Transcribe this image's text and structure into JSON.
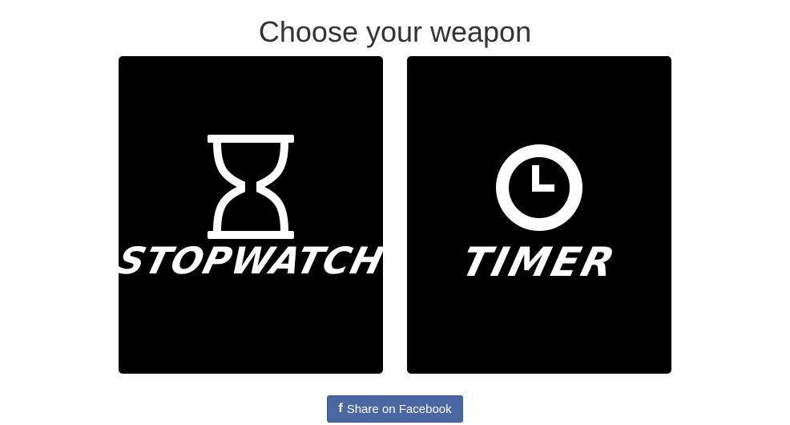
{
  "header": {
    "title": "Choose your weapon"
  },
  "cards": [
    {
      "label": "STOPWATCH",
      "icon": "hourglass-icon"
    },
    {
      "label": "TIMER",
      "icon": "clock-icon"
    }
  ],
  "share": {
    "icon_glyph": "f",
    "icon": "facebook-icon",
    "label": "Share on Facebook",
    "color": "#4a67a1"
  }
}
